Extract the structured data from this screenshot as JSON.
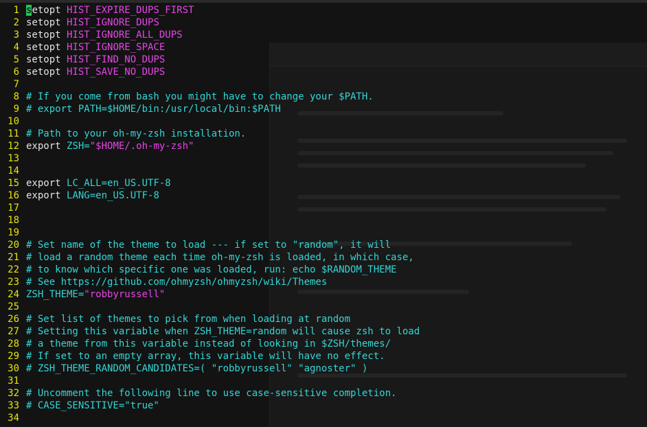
{
  "editor": {
    "lines": [
      {
        "n": "1",
        "segs": [
          {
            "t": "s",
            "c": "cursor"
          },
          {
            "t": "etopt ",
            "c": "kw"
          },
          {
            "t": "HIST_EXPIRE_DUPS_FIRST",
            "c": "mg"
          }
        ]
      },
      {
        "n": "2",
        "segs": [
          {
            "t": "setopt ",
            "c": "kw"
          },
          {
            "t": "HIST_IGNORE_DUPS",
            "c": "mg"
          }
        ]
      },
      {
        "n": "3",
        "segs": [
          {
            "t": "setopt ",
            "c": "kw"
          },
          {
            "t": "HIST_IGNORE_ALL_DUPS",
            "c": "mg"
          }
        ]
      },
      {
        "n": "4",
        "segs": [
          {
            "t": "setopt ",
            "c": "kw"
          },
          {
            "t": "HIST_IGNORE_SPACE",
            "c": "mg"
          }
        ]
      },
      {
        "n": "5",
        "segs": [
          {
            "t": "setopt ",
            "c": "kw"
          },
          {
            "t": "HIST_FIND_NO_DUPS",
            "c": "mg"
          }
        ]
      },
      {
        "n": "6",
        "segs": [
          {
            "t": "setopt ",
            "c": "kw"
          },
          {
            "t": "HIST_SAVE_NO_DUPS",
            "c": "mg"
          }
        ]
      },
      {
        "n": "7",
        "segs": []
      },
      {
        "n": "8",
        "segs": [
          {
            "t": "# If you come from bash you might have to change your $PATH.",
            "c": "cm"
          }
        ]
      },
      {
        "n": "9",
        "segs": [
          {
            "t": "# export PATH=$HOME/bin:/usr/local/bin:$PATH",
            "c": "cm"
          }
        ]
      },
      {
        "n": "10",
        "segs": []
      },
      {
        "n": "11",
        "segs": [
          {
            "t": "# Path to your oh-my-zsh installation.",
            "c": "cm"
          }
        ]
      },
      {
        "n": "12",
        "segs": [
          {
            "t": "export ",
            "c": "kw"
          },
          {
            "t": "ZSH=",
            "c": "cm"
          },
          {
            "t": "\"$HOME/.oh-my-zsh\"",
            "c": "st"
          }
        ]
      },
      {
        "n": "13",
        "segs": []
      },
      {
        "n": "14",
        "segs": []
      },
      {
        "n": "15",
        "segs": [
          {
            "t": "export ",
            "c": "kw"
          },
          {
            "t": "LC_ALL=en_US.UTF-8",
            "c": "cm"
          }
        ]
      },
      {
        "n": "16",
        "segs": [
          {
            "t": "export ",
            "c": "kw"
          },
          {
            "t": "LANG=en_US.UTF-8",
            "c": "cm"
          }
        ]
      },
      {
        "n": "17",
        "segs": []
      },
      {
        "n": "18",
        "segs": []
      },
      {
        "n": "19",
        "segs": []
      },
      {
        "n": "20",
        "segs": [
          {
            "t": "# Set name of the theme to load --- if set to \"random\", it will",
            "c": "cm"
          }
        ]
      },
      {
        "n": "21",
        "segs": [
          {
            "t": "# load a random theme each time oh-my-zsh is loaded, in which case,",
            "c": "cm"
          }
        ]
      },
      {
        "n": "22",
        "segs": [
          {
            "t": "# to know which specific one was loaded, run: echo $RANDOM_THEME",
            "c": "cm"
          }
        ]
      },
      {
        "n": "23",
        "segs": [
          {
            "t": "# See https://github.com/ohmyzsh/ohmyzsh/wiki/Themes",
            "c": "cm"
          }
        ]
      },
      {
        "n": "24",
        "segs": [
          {
            "t": "ZSH_THEME=",
            "c": "cm"
          },
          {
            "t": "\"robbyrussell\"",
            "c": "st"
          }
        ]
      },
      {
        "n": "25",
        "segs": []
      },
      {
        "n": "26",
        "segs": [
          {
            "t": "# Set list of themes to pick from when loading at random",
            "c": "cm"
          }
        ]
      },
      {
        "n": "27",
        "segs": [
          {
            "t": "# Setting this variable when ZSH_THEME=random will cause zsh to load",
            "c": "cm"
          }
        ]
      },
      {
        "n": "28",
        "segs": [
          {
            "t": "# a theme from this variable instead of looking in $ZSH/themes/",
            "c": "cm"
          }
        ]
      },
      {
        "n": "29",
        "segs": [
          {
            "t": "# If set to an empty array, this variable will have no effect.",
            "c": "cm"
          }
        ]
      },
      {
        "n": "30",
        "segs": [
          {
            "t": "# ZSH_THEME_RANDOM_CANDIDATES=( \"robbyrussell\" \"agnoster\" )",
            "c": "cm"
          }
        ]
      },
      {
        "n": "31",
        "segs": []
      },
      {
        "n": "32",
        "segs": [
          {
            "t": "# Uncomment the following line to use case-sensitive completion.",
            "c": "cm"
          }
        ]
      },
      {
        "n": "33",
        "segs": [
          {
            "t": "# CASE_SENSITIVE=\"true\"",
            "c": "cm"
          }
        ]
      },
      {
        "n": "34",
        "segs": []
      }
    ]
  },
  "colors": {
    "background": "#131313",
    "line_number": "#e5e510",
    "keyword": "#e4e4e4",
    "option_name": "#e845e8",
    "comment": "#33d6d6",
    "cursor": "#23c35a"
  }
}
